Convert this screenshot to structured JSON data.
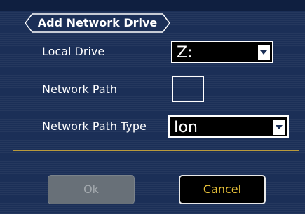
{
  "dialog": {
    "title": "Add Network Drive",
    "local_drive": {
      "label": "Local Drive",
      "value": "Z:"
    },
    "network_path": {
      "label": "Network Path",
      "value": ""
    },
    "network_path_type": {
      "label": "Network Path Type",
      "value": "Ion"
    },
    "buttons": {
      "ok": "Ok",
      "cancel": "Cancel"
    }
  },
  "colors": {
    "background": "#1b2f57",
    "frame_border": "#b99a3c",
    "cancel_text": "#e8c23a",
    "ok_disabled_bg": "#687078"
  }
}
